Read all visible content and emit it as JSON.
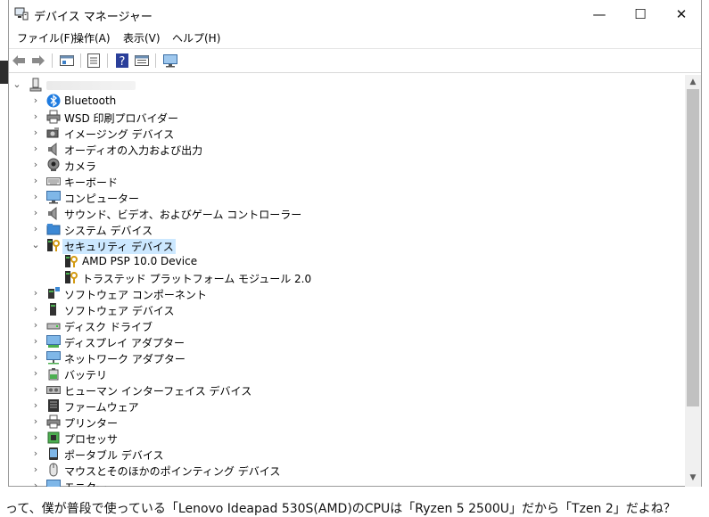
{
  "window": {
    "title": "デバイス マネージャー",
    "controls": {
      "minimize": "—",
      "maximize": "☐",
      "close": "✕"
    }
  },
  "menu": [
    "ファイル(F)",
    "操作(A)",
    "表示(V)",
    "ヘルプ(H)"
  ],
  "toolbar": [
    "back-arrow-icon",
    "forward-arrow-icon",
    "properties-icon",
    "list-icon",
    "help-icon",
    "view-icon",
    "monitor-icon"
  ],
  "tree": {
    "root_icon": "computer-icon",
    "items": [
      {
        "label": "Bluetooth",
        "icon": "bluetooth-icon",
        "expanded": false
      },
      {
        "label": "WSD 印刷プロバイダー",
        "icon": "printer-icon",
        "expanded": false
      },
      {
        "label": "イメージング デバイス",
        "icon": "camera-icon",
        "expanded": false
      },
      {
        "label": "オーディオの入力および出力",
        "icon": "speaker-icon",
        "expanded": false
      },
      {
        "label": "カメラ",
        "icon": "webcam-icon",
        "expanded": false
      },
      {
        "label": "キーボード",
        "icon": "keyboard-icon",
        "expanded": false
      },
      {
        "label": "コンピューター",
        "icon": "monitor-icon",
        "expanded": false
      },
      {
        "label": "サウンド、ビデオ、およびゲーム コントローラー",
        "icon": "speaker-icon",
        "expanded": false
      },
      {
        "label": "システム デバイス",
        "icon": "folder-icon",
        "expanded": false
      },
      {
        "label": "セキュリティ デバイス",
        "icon": "security-key-icon",
        "expanded": true,
        "selected": true
      },
      {
        "label": "AMD PSP 10.0 Device",
        "icon": "security-key-icon",
        "child": true
      },
      {
        "label": "トラステッド プラットフォーム モジュール 2.0",
        "icon": "security-key-icon",
        "child": true
      },
      {
        "label": "ソフトウェア コンポーネント",
        "icon": "component-icon",
        "expanded": false
      },
      {
        "label": "ソフトウェア デバイス",
        "icon": "device-icon",
        "expanded": false
      },
      {
        "label": "ディスク ドライブ",
        "icon": "disk-icon",
        "expanded": false
      },
      {
        "label": "ディスプレイ アダプター",
        "icon": "display-icon",
        "expanded": false
      },
      {
        "label": "ネットワーク アダプター",
        "icon": "network-icon",
        "expanded": false
      },
      {
        "label": "バッテリ",
        "icon": "battery-icon",
        "expanded": false
      },
      {
        "label": "ヒューマン インターフェイス デバイス",
        "icon": "hid-icon",
        "expanded": false
      },
      {
        "label": "ファームウェア",
        "icon": "firmware-icon",
        "expanded": false
      },
      {
        "label": "プリンター",
        "icon": "printer-icon",
        "expanded": false
      },
      {
        "label": "プロセッサ",
        "icon": "processor-icon",
        "expanded": false
      },
      {
        "label": "ポータブル デバイス",
        "icon": "portable-icon",
        "expanded": false
      },
      {
        "label": "マウスとそのほかのポインティング デバイス",
        "icon": "mouse-icon",
        "expanded": false
      },
      {
        "label": "モニター",
        "icon": "monitor-icon",
        "expanded": false
      }
    ]
  },
  "background_text": {
    "bottom": "って、僕が普段で使っている「Lenovo Ideapad 530S(AMD)のCPUは「Ryzen 5 2500U」だから「Tzen 2」だよね？"
  },
  "colors": {
    "selection": "#cce8ff",
    "scroll_thumb": "#c1c1c1",
    "scroll_track": "#f0f0f0",
    "accent": "#0063b1"
  }
}
